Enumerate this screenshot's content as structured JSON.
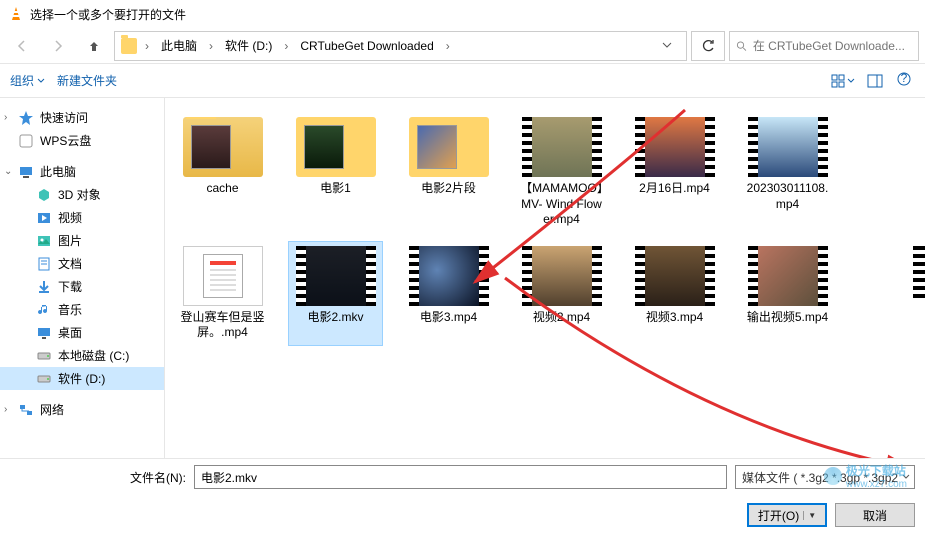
{
  "window": {
    "title": "选择一个或多个要打开的文件"
  },
  "breadcrumb": {
    "items": [
      "此电脑",
      "软件 (D:)",
      "CRTubeGet Downloaded"
    ]
  },
  "search": {
    "placeholder": "在 CRTubeGet Downloade..."
  },
  "toolbar": {
    "organize": "组织",
    "new_folder": "新建文件夹"
  },
  "sidebar": {
    "items": [
      {
        "label": "快速访问",
        "icon": "star"
      },
      {
        "label": "WPS云盘",
        "icon": "wps"
      },
      {
        "label": "此电脑",
        "icon": "pc",
        "expanded": true
      },
      {
        "label": "3D 对象",
        "icon": "3d",
        "sub": true
      },
      {
        "label": "视频",
        "icon": "video",
        "sub": true
      },
      {
        "label": "图片",
        "icon": "pic",
        "sub": true
      },
      {
        "label": "文档",
        "icon": "doc",
        "sub": true
      },
      {
        "label": "下载",
        "icon": "dl",
        "sub": true
      },
      {
        "label": "音乐",
        "icon": "music",
        "sub": true
      },
      {
        "label": "桌面",
        "icon": "desk",
        "sub": true
      },
      {
        "label": "本地磁盘 (C:)",
        "icon": "disk",
        "sub": true
      },
      {
        "label": "软件 (D:)",
        "icon": "disk",
        "sub": true,
        "selected": true
      },
      {
        "label": "网络",
        "icon": "net"
      }
    ]
  },
  "files": [
    {
      "label": "cache",
      "type": "folder",
      "thumb": "folder1"
    },
    {
      "label": "电影1",
      "type": "folder",
      "thumb": "folder2"
    },
    {
      "label": "电影2片段",
      "type": "folder",
      "thumb": "folder3"
    },
    {
      "label": "【MAMAMOO】MV- Wind Flower.mp4",
      "type": "video",
      "bg": "linear-gradient(#a79b6f, #6f7456)"
    },
    {
      "label": "2月16日.mp4",
      "type": "video",
      "bg": "linear-gradient(#e07843,#3a2b49)"
    },
    {
      "label": "202303011108.mp4",
      "type": "video",
      "bg": "linear-gradient(#c7e6f7,#2b4a7a)"
    },
    {
      "label": "登山赛车但是竖屏。.mp4",
      "type": "app"
    },
    {
      "label": "电影2.mkv",
      "type": "video",
      "bg": "linear-gradient(#1c1f26,#0b1018)",
      "selected": true
    },
    {
      "label": "电影3.mp4",
      "type": "video",
      "bg": "radial-gradient(circle at 30% 40%,#5f83b4,#0a1224)"
    },
    {
      "label": "视频2.mp4",
      "type": "video",
      "bg": "linear-gradient(#caa472,#51402e)"
    },
    {
      "label": "视频3.mp4",
      "type": "video",
      "bg": "linear-gradient(#705536,#2a2018)"
    },
    {
      "label": "输出视频5.mp4",
      "type": "video",
      "bg": "linear-gradient(135deg,#b97460,#5d503c)"
    }
  ],
  "footer": {
    "filename_label": "文件名(N):",
    "filename_value": "电影2.mkv",
    "filter": "媒体文件 ( *.3g2 *.3gp *.3gp2",
    "open_btn": "打开(O)",
    "cancel_btn": "取消"
  },
  "watermark": {
    "site": "极光下载站",
    "url": "www.xz7.com"
  }
}
